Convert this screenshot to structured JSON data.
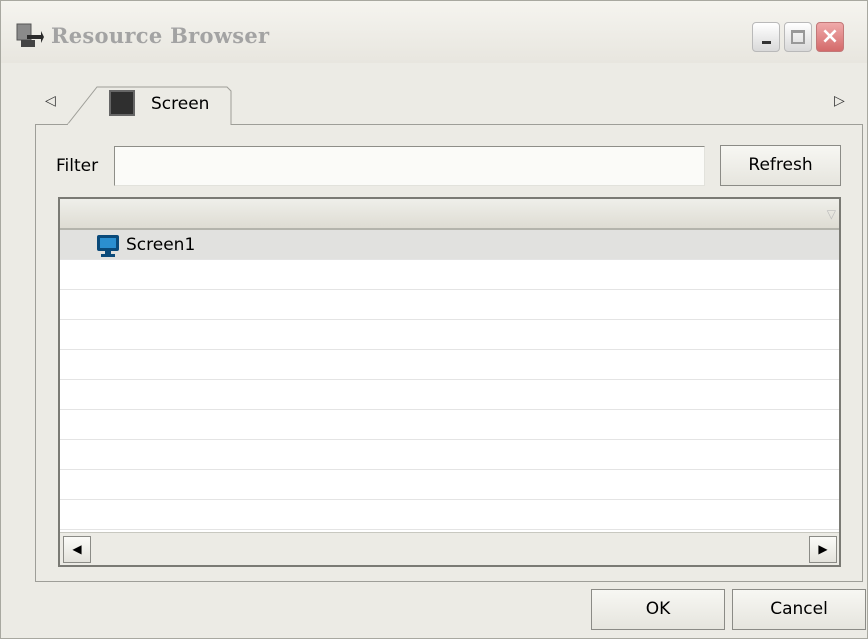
{
  "window": {
    "title": "Resource Browser",
    "controls": {
      "minimize": "minimize",
      "maximize": "maximize",
      "close": "×"
    }
  },
  "tabs": {
    "scroll_left": "◁",
    "scroll_right": "▷",
    "items": [
      {
        "label": "Screen",
        "icon": "screen-icon",
        "active": true
      }
    ]
  },
  "filter": {
    "label": "Filter",
    "value": "",
    "placeholder": ""
  },
  "buttons": {
    "refresh": "Refresh",
    "ok": "OK",
    "cancel": "Cancel"
  },
  "list": {
    "header_glyph": "▽",
    "items": [
      {
        "label": "Screen1",
        "icon": "monitor-icon",
        "selected": true
      }
    ],
    "scroll_left": "◀",
    "scroll_right": "▶"
  },
  "colors": {
    "accent_monitor": "#0a4a7a",
    "selected_row": "#e1e1df",
    "close_button": "#d46a6a"
  }
}
